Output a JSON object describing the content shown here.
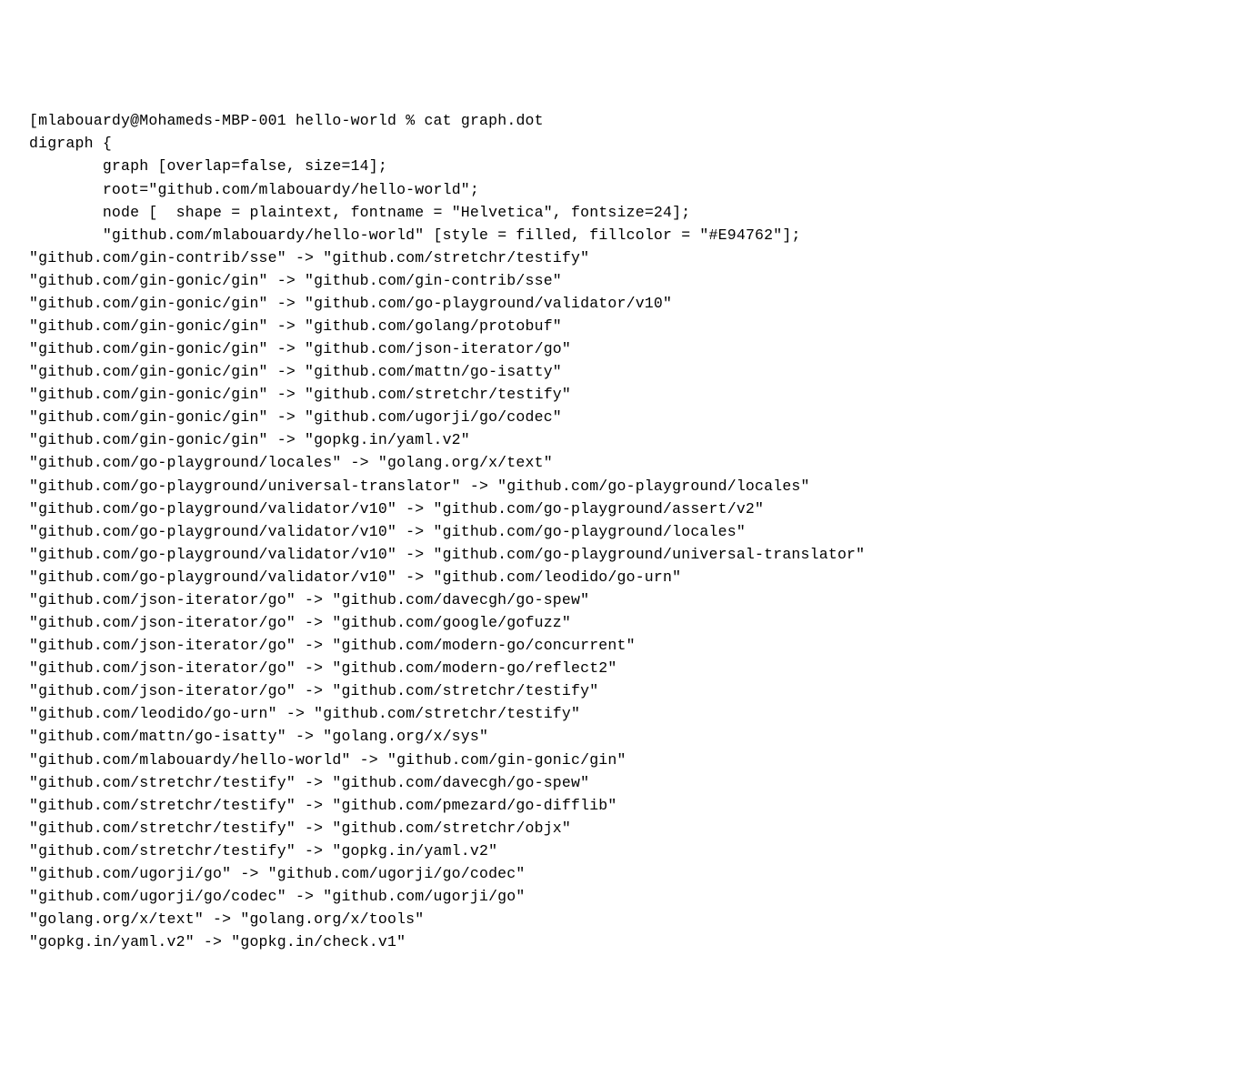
{
  "prompt": {
    "open_bracket": "[",
    "user": "mlabouardy",
    "at": "@",
    "host": "Mohameds-MBP-001",
    "space": " ",
    "dir": "hello-world",
    "marker": " % ",
    "command": "cat graph.dot"
  },
  "digraph_open": "digraph {",
  "config": {
    "indent": "        ",
    "graph_attrs": "graph [overlap=false, size=14];",
    "root": "root=\"github.com/mlabouardy/hello-world\";",
    "node_attrs": "node [  shape = plaintext, fontname = \"Helvetica\", fontsize=24];",
    "root_node": "\"github.com/mlabouardy/hello-world\" [style = filled, fillcolor = \"#E94762\"];"
  },
  "edges": [
    "\"github.com/gin-contrib/sse\" -> \"github.com/stretchr/testify\"",
    "\"github.com/gin-gonic/gin\" -> \"github.com/gin-contrib/sse\"",
    "\"github.com/gin-gonic/gin\" -> \"github.com/go-playground/validator/v10\"",
    "\"github.com/gin-gonic/gin\" -> \"github.com/golang/protobuf\"",
    "\"github.com/gin-gonic/gin\" -> \"github.com/json-iterator/go\"",
    "\"github.com/gin-gonic/gin\" -> \"github.com/mattn/go-isatty\"",
    "\"github.com/gin-gonic/gin\" -> \"github.com/stretchr/testify\"",
    "\"github.com/gin-gonic/gin\" -> \"github.com/ugorji/go/codec\"",
    "\"github.com/gin-gonic/gin\" -> \"gopkg.in/yaml.v2\"",
    "\"github.com/go-playground/locales\" -> \"golang.org/x/text\"",
    "\"github.com/go-playground/universal-translator\" -> \"github.com/go-playground/locales\"",
    "\"github.com/go-playground/validator/v10\" -> \"github.com/go-playground/assert/v2\"",
    "\"github.com/go-playground/validator/v10\" -> \"github.com/go-playground/locales\"",
    "\"github.com/go-playground/validator/v10\" -> \"github.com/go-playground/universal-translator\"",
    "\"github.com/go-playground/validator/v10\" -> \"github.com/leodido/go-urn\"",
    "\"github.com/json-iterator/go\" -> \"github.com/davecgh/go-spew\"",
    "\"github.com/json-iterator/go\" -> \"github.com/google/gofuzz\"",
    "\"github.com/json-iterator/go\" -> \"github.com/modern-go/concurrent\"",
    "\"github.com/json-iterator/go\" -> \"github.com/modern-go/reflect2\"",
    "\"github.com/json-iterator/go\" -> \"github.com/stretchr/testify\"",
    "\"github.com/leodido/go-urn\" -> \"github.com/stretchr/testify\"",
    "\"github.com/mattn/go-isatty\" -> \"golang.org/x/sys\"",
    "\"github.com/mlabouardy/hello-world\" -> \"github.com/gin-gonic/gin\"",
    "\"github.com/stretchr/testify\" -> \"github.com/davecgh/go-spew\"",
    "\"github.com/stretchr/testify\" -> \"github.com/pmezard/go-difflib\"",
    "\"github.com/stretchr/testify\" -> \"github.com/stretchr/objx\"",
    "\"github.com/stretchr/testify\" -> \"gopkg.in/yaml.v2\"",
    "\"github.com/ugorji/go\" -> \"github.com/ugorji/go/codec\"",
    "\"github.com/ugorji/go/codec\" -> \"github.com/ugorji/go\"",
    "\"golang.org/x/text\" -> \"golang.org/x/tools\"",
    "\"gopkg.in/yaml.v2\" -> \"gopkg.in/check.v1\""
  ]
}
